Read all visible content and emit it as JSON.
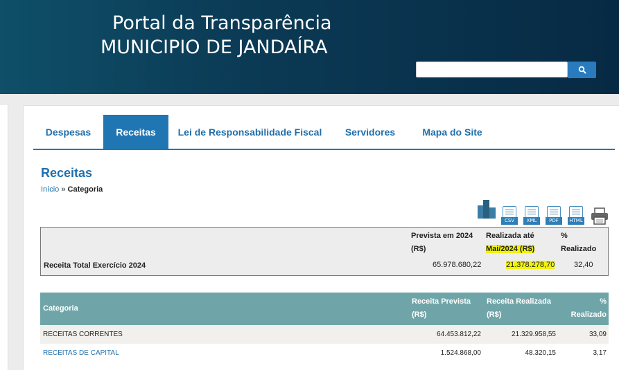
{
  "header": {
    "line1": "Portal da Transparência",
    "line2": "MUNICIPIO DE JANDAÍRA",
    "search_placeholder": ""
  },
  "tabs": [
    {
      "label": "Despesas",
      "active": false
    },
    {
      "label": "Receitas",
      "active": true
    },
    {
      "label": "Lei de Responsabilidade Fiscal",
      "active": false
    },
    {
      "label": "Servidores",
      "active": false
    },
    {
      "label": "Mapa do Site",
      "active": false
    }
  ],
  "page": {
    "title": "Receitas",
    "breadcrumb_home": "Início",
    "breadcrumb_sep": "»",
    "breadcrumb_current": "Categoria"
  },
  "exports": [
    "CSV",
    "XML",
    "PDF",
    "HTML"
  ],
  "summary": {
    "col1_line1": "Prevista em 2024",
    "col1_line2": "(R$)",
    "col2_line1": "Realizada até",
    "col2_line2": "Mai/2024 (R$)",
    "col3_line1": "%",
    "col3_line2": "Realizado",
    "row_label": "Receita Total Exercício 2024",
    "prevista": "65.978.680,22",
    "realizada": "21.378.278,70",
    "percent": "32,40"
  },
  "category_table": {
    "headers": {
      "categoria": "Categoria",
      "prevista_line1": "Receita Prevista",
      "prevista_line2": "(R$)",
      "realizada_line1": "Receita Realizada",
      "realizada_line2": "(R$)",
      "pct_line1": "%",
      "pct_line2": "Realizado"
    },
    "rows": [
      {
        "categoria": "RECEITAS CORRENTES",
        "prevista": "64.453.812,22",
        "realizada": "21.329.958,55",
        "pct": "33,09"
      },
      {
        "categoria": "RECEITAS DE CAPITAL",
        "prevista": "1.524.868,00",
        "realizada": "48.320,15",
        "pct": "3,17"
      }
    ]
  },
  "colors": {
    "header_bg": "#0b3a55",
    "accent": "#1f76b3",
    "table_header": "#6fa5a8",
    "highlight": "#f2f20a"
  }
}
